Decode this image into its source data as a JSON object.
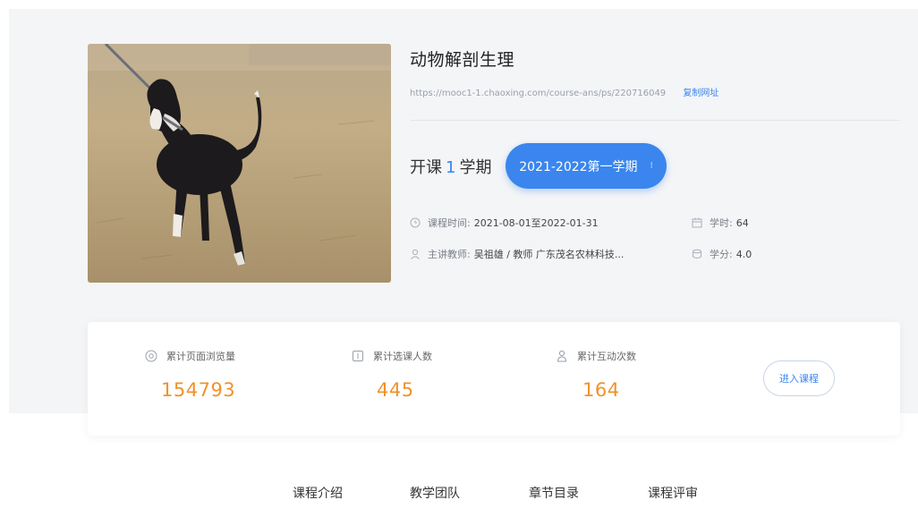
{
  "course": {
    "title": "动物解剖生理",
    "url": "https://mooc1-1.chaoxing.com/course-ans/ps/220716049",
    "copy_label": "复制网址"
  },
  "term": {
    "prefix": "开课",
    "count": "1",
    "suffix": "学期",
    "semester_label": "2021-2022第一学期",
    "caret": "⌃⌄"
  },
  "meta": {
    "time_label": "课程时间:",
    "time_value": "2021-08-01至2022-01-31",
    "teacher_label": "主讲教师:",
    "teacher_value": "吴祖雄 / 教师 广东茂名农林科技...",
    "hours_label": "学时:",
    "hours_value": "64",
    "credits_label": "学分:",
    "credits_value": "4.0"
  },
  "stats": [
    {
      "label": "累计页面浏览量",
      "value": "154793",
      "icon": "eye-icon"
    },
    {
      "label": "累计选课人数",
      "value": "445",
      "icon": "book-icon"
    },
    {
      "label": "累计互动次数",
      "value": "164",
      "icon": "person-icon"
    }
  ],
  "enter_button": "进入课程",
  "tabs": [
    "课程介绍",
    "教学团队",
    "章节目录",
    "课程评审"
  ],
  "colors": {
    "accent": "#3a86ee",
    "stat_value": "#f0922b",
    "hero_bg": "#f4f5f7"
  }
}
